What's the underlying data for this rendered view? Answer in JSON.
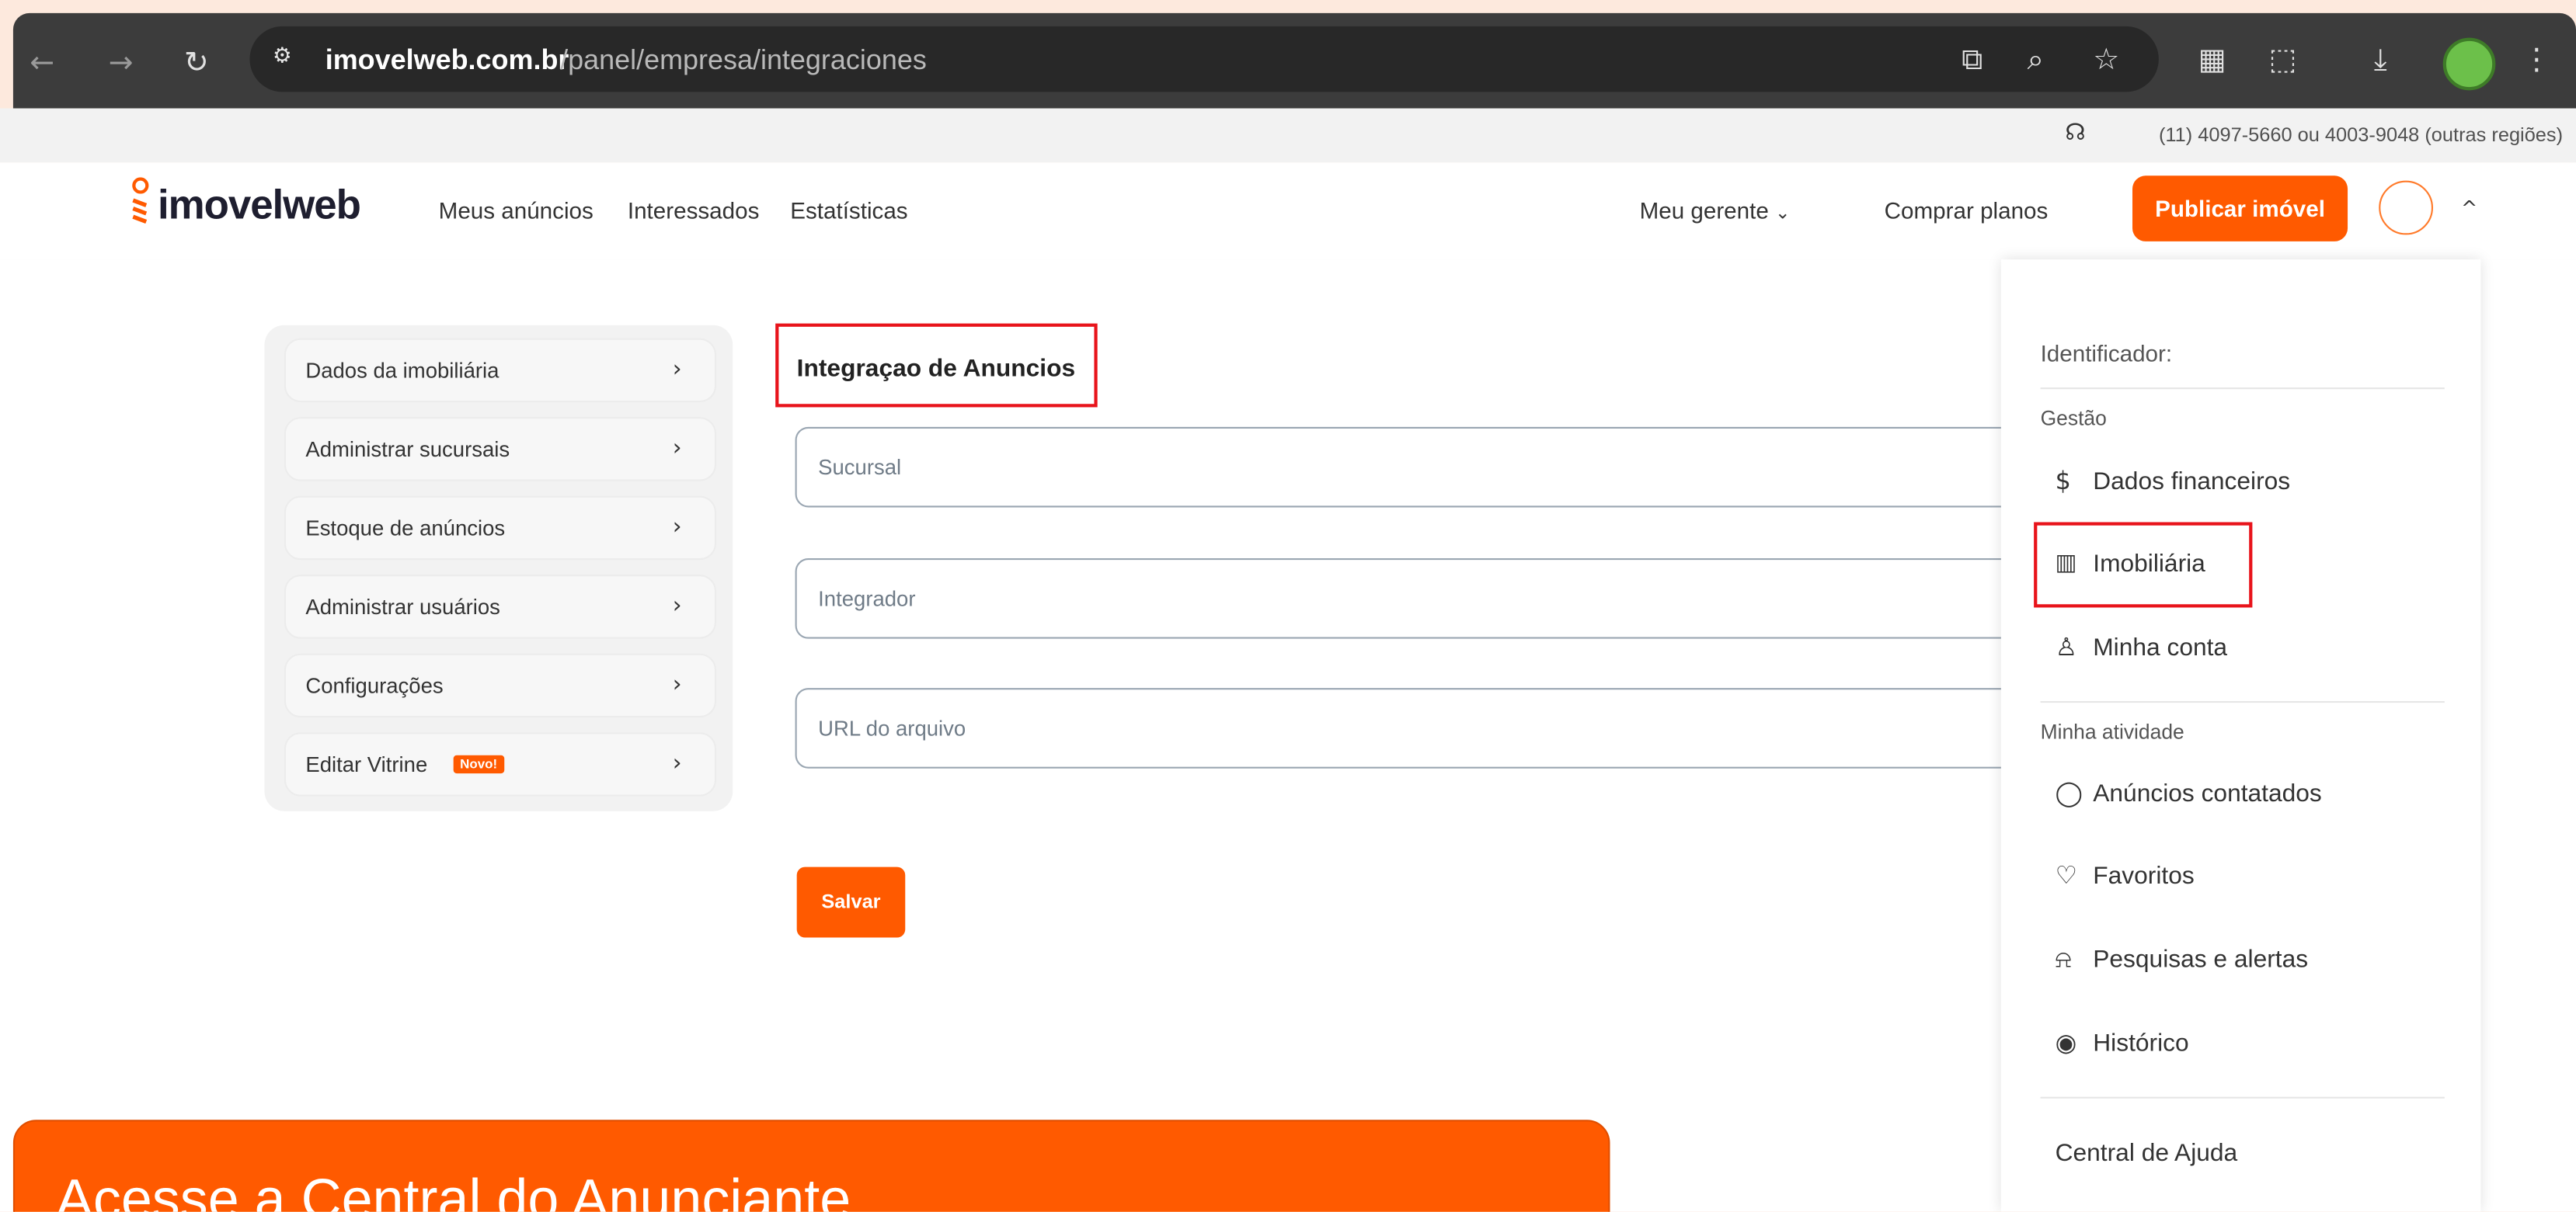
{
  "browser": {
    "url_domain": "imovelweb.com.br",
    "url_path": "/panel/empresa/integraciones"
  },
  "support": {
    "text": "(11) 4097-5660 ou 4003-9048 (outras regiões)"
  },
  "header": {
    "logo": "imovelweb",
    "nav": [
      "Meus anúncios",
      "Interessados",
      "Estatísticas"
    ],
    "meu_gerente": "Meu gerente",
    "comprar_planos": "Comprar planos",
    "publicar": "Publicar imóvel"
  },
  "sidebar": {
    "items": [
      {
        "label": "Dados da imobiliária"
      },
      {
        "label": "Administrar sucursais"
      },
      {
        "label": "Estoque de anúncios"
      },
      {
        "label": "Administrar usuários"
      },
      {
        "label": "Configurações"
      },
      {
        "label": "Editar Vitrine"
      }
    ],
    "badge": "Novo!"
  },
  "form": {
    "title": "Integraçao de Anuncios",
    "fields": {
      "sucursal": "Sucursal",
      "integrador": "Integrador",
      "url": "URL do arquivo"
    },
    "save": "Salvar"
  },
  "dropdown": {
    "identificador": "Identificador:",
    "gestao": "Gestão",
    "dados_financeiros": "Dados financeiros",
    "imobiliaria": "Imobiliária",
    "minha_conta": "Minha conta",
    "minha_atividade": "Minha atividade",
    "anuncios_contatados": "Anúncios contatados",
    "favoritos": "Favoritos",
    "pesquisas": "Pesquisas e alertas",
    "historico": "Histórico",
    "ajuda": "Central de Ajuda"
  },
  "banner": {
    "text": "Acesse a Central do Anunciante"
  },
  "colors": {
    "brand_orange": "#ff5a00",
    "highlight_red": "#e8141b"
  }
}
